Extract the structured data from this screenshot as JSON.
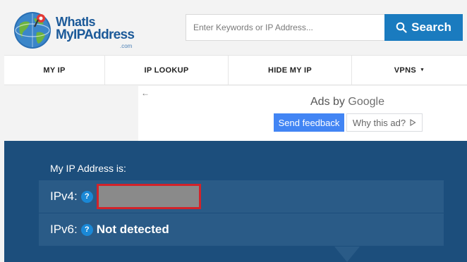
{
  "header": {
    "logo": {
      "line1": "WhatIs",
      "line2": "MyIPAddress",
      "line3": ".com"
    },
    "search": {
      "placeholder": "Enter Keywords or IP Address...",
      "button_label": "Search"
    }
  },
  "nav": {
    "items": [
      {
        "label": "MY IP"
      },
      {
        "label": "IP LOOKUP"
      },
      {
        "label": "HIDE MY IP"
      },
      {
        "label": "VPNS",
        "has_dropdown": true
      }
    ]
  },
  "ad": {
    "ads_by": "Ads by",
    "google": "Google",
    "feedback_label": "Send feedback",
    "why_label": "Why this ad?"
  },
  "ip_panel": {
    "title": "My IP Address is:",
    "ipv4_label": "IPv4:",
    "ipv6_label": "IPv6:",
    "ipv6_value": "Not detected",
    "help_symbol": "?"
  },
  "colors": {
    "brand_blue": "#1a7bbf",
    "panel_bg": "#1c4e7c",
    "row_bg": "#2a5b87",
    "redaction_border": "#d2232a"
  }
}
